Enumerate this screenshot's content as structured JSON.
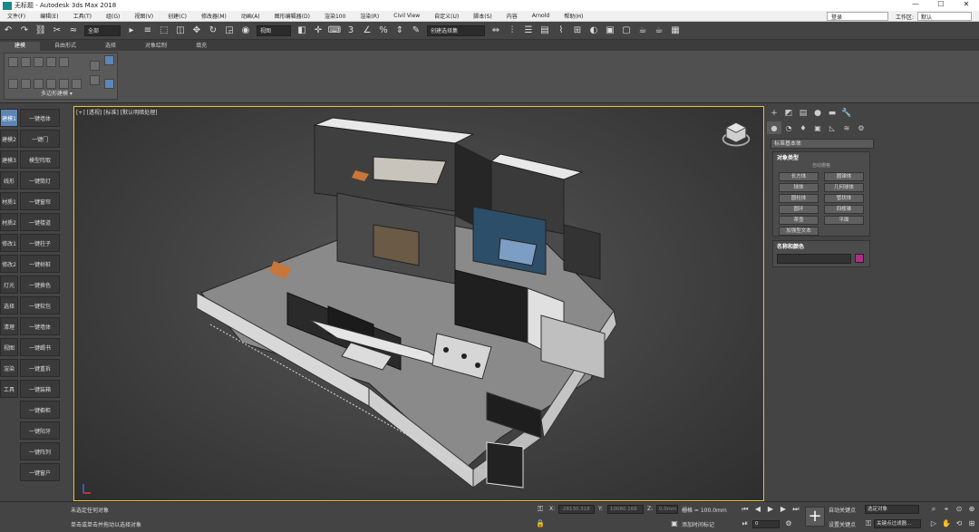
{
  "app": {
    "title": "无标题 - Autodesk 3ds Max 2018"
  },
  "window_controls": {
    "minimize": "—",
    "maximize": "☐",
    "close": "✕"
  },
  "menu": [
    "文件(F)",
    "编辑(E)",
    "工具(T)",
    "组(G)",
    "视图(V)",
    "创建(C)",
    "修改器(M)",
    "动画(A)",
    "图形编辑器(D)",
    "渲染100",
    "渲染(R)",
    "Civil View",
    "自定义(U)",
    "脚本(S)",
    "内容",
    "Arnold",
    "帮助(H)"
  ],
  "workspace": {
    "login": "登录",
    "label": "工作区:",
    "value": "默认"
  },
  "toolbar": {
    "selection_filter": "全部",
    "ref_coord": "视图",
    "named_selection": "创建选择集"
  },
  "ribbon": {
    "tabs": [
      "建模",
      "自由形式",
      "选择",
      "对象绘制",
      "填充"
    ],
    "group_label": "多边形建模 ▾"
  },
  "left_tools": {
    "col1": [
      "建模1",
      "建模2",
      "建模3",
      "线形",
      "材质1",
      "材质2",
      "修改1",
      "修改2",
      "灯光",
      "选择",
      "清理",
      "视图",
      "渲染",
      "工具"
    ],
    "col2": [
      "一键墙体",
      "一键门",
      "模型阵取",
      "一键筒灯",
      "一键窗帘",
      "一键楼道",
      "一键柱子",
      "一键树桩",
      "一键换色",
      "一键软包",
      "一键墙体",
      "一键踢书",
      "一键重拆",
      "一键装箱",
      "一键橱柜",
      "一键阳牙",
      "一键阵列",
      "一键窗户"
    ]
  },
  "viewport": {
    "label": "[+] [透视] [标准] [默认明暗处理]"
  },
  "command_panel": {
    "category": "标准基本体",
    "object_type_title": "对象类型",
    "autogrid": "自动栅格",
    "objects": [
      "长方体",
      "圆锥体",
      "球体",
      "几何球体",
      "圆柱体",
      "管状体",
      "圆环",
      "四棱锥",
      "茶壶",
      "平面"
    ],
    "extra_object": "加强型文本",
    "name_color_title": "名称和颜色",
    "object_color": "#b02e8a"
  },
  "status": {
    "selection": "未选定任何对象",
    "prompt": "单击或单击并拖动以选择对象",
    "x_label": "X:",
    "x_value": "-28130.318",
    "y_label": "Y:",
    "y_value": "10080.168",
    "z_label": "Z:",
    "z_value": "0.0mm",
    "grid": "栅格 = 100.0mm",
    "add_time_tag": "添加时间标记",
    "autokey": "自动关键点",
    "autokey_select": "选定对象",
    "setkey": "设置关键点",
    "keyfilters": "关键点过滤器...",
    "frame": "0"
  },
  "colors": {
    "accent": "#5b86b6",
    "viewport_border": "#e8c23a"
  }
}
